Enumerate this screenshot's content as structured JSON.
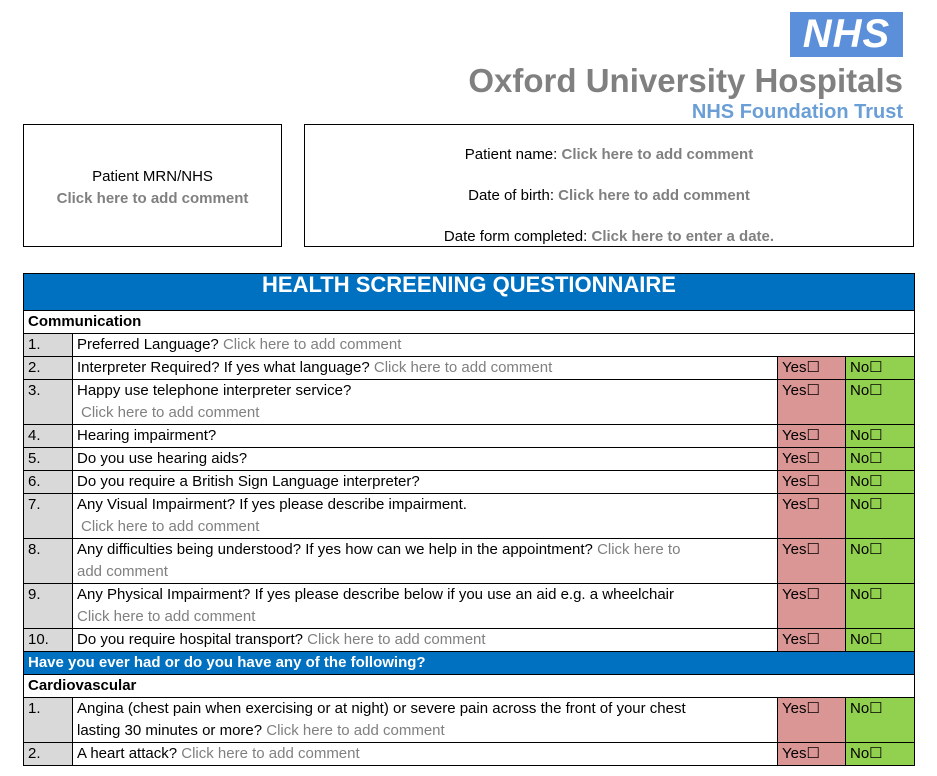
{
  "header": {
    "logo_text": "NHS",
    "org_name": "Oxford University Hospitals",
    "org_sub": "NHS Foundation Trust"
  },
  "patient_box": {
    "mrn_label": "Patient MRN/NHS",
    "mrn_placeholder": "Click here to add comment",
    "name_label": "Patient name:",
    "name_placeholder": "Click here to add comment",
    "dob_label": "Date of birth:",
    "dob_placeholder": "Click here to add comment",
    "date_label": "Date form completed:",
    "date_placeholder": "Click here to enter a date."
  },
  "questionnaire": {
    "title": "HEALTH SCREENING QUESTIONNAIRE",
    "yes_label": "Yes☐",
    "no_label": "No☐",
    "section1": "Communication",
    "section2_banner": "Have you ever had or do you have any of the following?",
    "section2": "Cardiovascular",
    "comm": [
      {
        "num": "1.",
        "text": "Preferred Language?",
        "ph": "Click here to add comment"
      },
      {
        "num": "2.",
        "text": "Interpreter Required? If yes what language?",
        "ph": "Click here to add comment"
      },
      {
        "num": "3.",
        "text": "Happy use telephone interpreter service?",
        "ph": "Click here to add comment"
      },
      {
        "num": "4.",
        "text": "Hearing impairment?"
      },
      {
        "num": "5.",
        "text": "Do you use hearing aids?"
      },
      {
        "num": "6.",
        "text": "Do you require a British Sign Language interpreter?"
      },
      {
        "num": "7.",
        "text": "Any Visual Impairment? If yes please describe impairment.",
        "ph": "Click here to add comment"
      },
      {
        "num": "8.",
        "text": "Any difficulties being understood?  If yes how can we help in the appointment?",
        "ph": "Click here to",
        "ph2": "add comment"
      },
      {
        "num": "9.",
        "text": "Any Physical Impairment?  If yes please describe below if you use an aid e.g. a wheelchair",
        "ph": "Click here to add comment"
      },
      {
        "num": "10.",
        "text": "Do you require hospital transport?",
        "ph": "Click here to add comment"
      }
    ],
    "cardio": [
      {
        "num": "1.",
        "text": "Angina (chest pain when exercising or at night) or severe pain across the front of your chest",
        "text2": "lasting 30 minutes or more?",
        "ph": "Click here to add comment"
      },
      {
        "num": "2.",
        "text": "A heart attack?",
        "ph": "Click here to add comment"
      }
    ]
  }
}
